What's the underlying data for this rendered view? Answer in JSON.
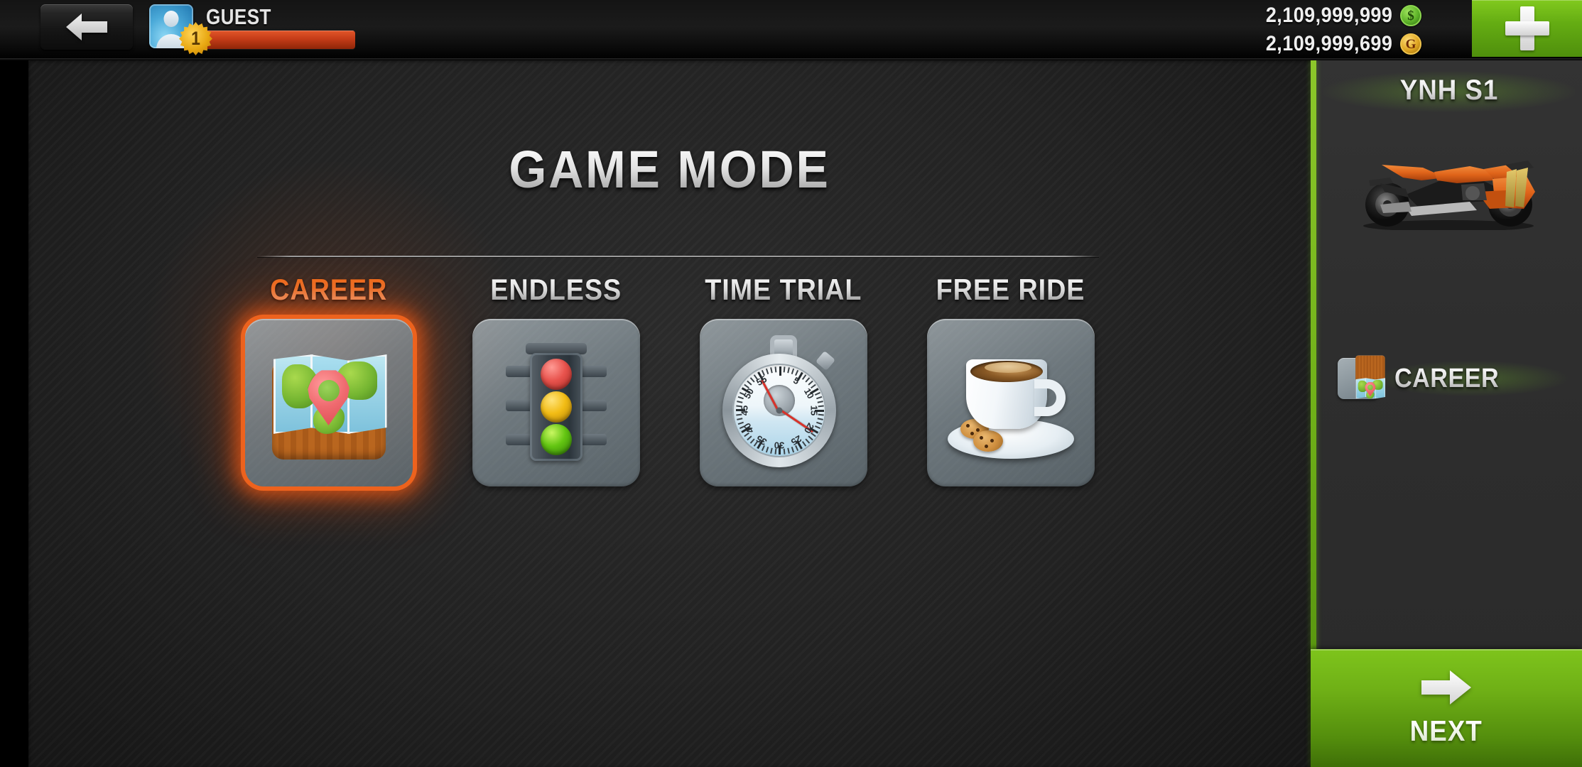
{
  "topbar": {
    "back_icon": "arrow-left-icon",
    "avatar_icon": "avatar-icon",
    "username": "GUEST",
    "level": "1",
    "xp_percent": 100,
    "currencies": [
      {
        "value": "2,109,999,999",
        "icon": "cash-coin-icon",
        "symbol": "$",
        "color": "#6fc42d"
      },
      {
        "value": "2,109,999,699",
        "icon": "gold-coin-icon",
        "symbol": "G",
        "color": "#e0a623"
      }
    ],
    "add_button_icon": "plus-icon"
  },
  "main": {
    "title": "GAME MODE",
    "modes": [
      {
        "label": "CAREER",
        "icon": "map-icon",
        "selected": true,
        "accent": "#f0651e"
      },
      {
        "label": "ENDLESS",
        "icon": "traffic-light-icon",
        "selected": false,
        "accent": "#d8d8d8"
      },
      {
        "label": "TIME TRIAL",
        "icon": "stopwatch-icon",
        "selected": false,
        "accent": "#d8d8d8"
      },
      {
        "label": "FREE RIDE",
        "icon": "coffee-cup-icon",
        "selected": false,
        "accent": "#d8d8d8"
      }
    ]
  },
  "stopwatch_dial": {
    "numbers": [
      "5",
      "10",
      "15",
      "20",
      "25",
      "30",
      "35",
      "40",
      "45",
      "50",
      "55"
    ]
  },
  "sidebar": {
    "vehicle_name": "YNH S1",
    "vehicle_icon": "motorcycle-icon",
    "selected_mode": {
      "label": "CAREER",
      "icon": "map-icon"
    },
    "next_button": {
      "label": "NEXT",
      "icon": "arrow-right-icon",
      "color": "#6fb016"
    }
  }
}
